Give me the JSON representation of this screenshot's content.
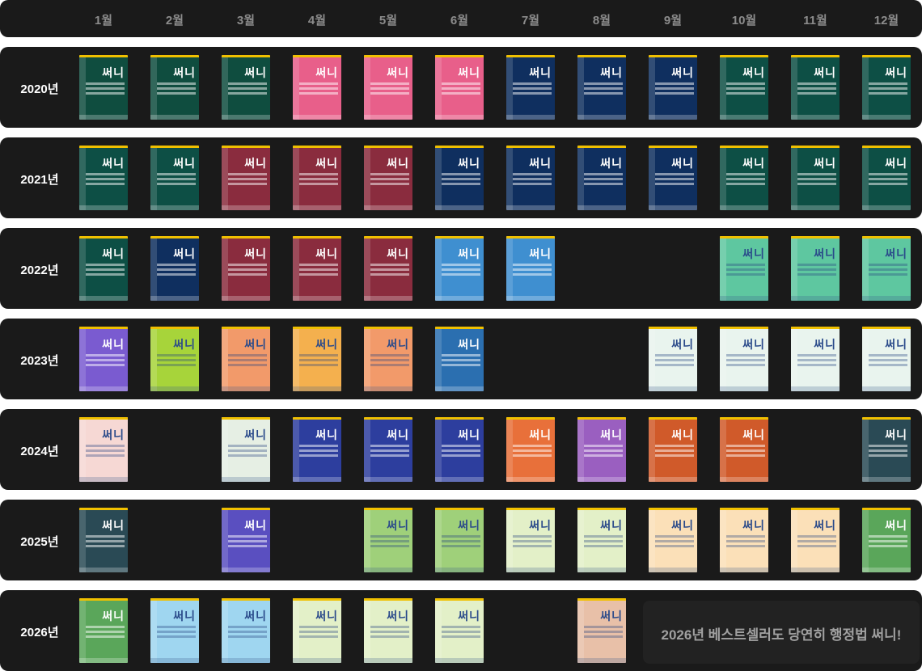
{
  "months": [
    "1월",
    "2월",
    "3월",
    "4월",
    "5월",
    "6월",
    "7월",
    "8월",
    "9월",
    "10월",
    "11월",
    "12월"
  ],
  "years": [
    "2020년",
    "2021년",
    "2022년",
    "2023년",
    "2024년",
    "2025년",
    "2026년"
  ],
  "book_brand": "써니",
  "rows": [
    {
      "year": "2020년",
      "covers": [
        "green",
        "green",
        "green",
        "pink",
        "pink",
        "pink",
        "navy",
        "navy",
        "navy",
        "teal",
        "teal",
        "teal"
      ]
    },
    {
      "year": "2021년",
      "covers": [
        "teal",
        "teal",
        "maroon",
        "maroon",
        "maroon",
        "navy",
        "navy",
        "navy",
        "navy",
        "teal",
        "teal",
        "teal"
      ]
    },
    {
      "year": "2022년",
      "covers": [
        "teal",
        "navy",
        "maroon",
        "maroon",
        "maroon",
        "sky",
        "sky",
        null,
        null,
        "mint",
        "mint",
        "mint"
      ]
    },
    {
      "year": "2023년",
      "covers": [
        "purple",
        "lime",
        "peach",
        "orange",
        "peach",
        "ocean",
        null,
        null,
        "seafoam",
        "seafoam",
        "seafoam",
        "seafoam"
      ]
    },
    {
      "year": "2024년",
      "covers": [
        "pastel",
        null,
        "botanic",
        "royal",
        "royal",
        "royal",
        "sunset",
        "violet",
        "dusk",
        "dusk",
        null,
        "night"
      ]
    },
    {
      "year": "2025년",
      "covers": [
        "night",
        null,
        "indigo",
        null,
        "field",
        "field",
        "lightgreen",
        "lightgreen",
        "cream",
        "cream",
        "cream",
        "meadow"
      ]
    },
    {
      "year": "2026년",
      "covers": [
        "meadow",
        "ice",
        "ice",
        "lightgreen",
        "lightgreen",
        "lightgreen",
        null,
        "blossom",
        null,
        null,
        null,
        null
      ]
    }
  ],
  "palette": {
    "green": "#0f4d3f",
    "teal": "#0d4f45",
    "pink": "#e85f8a",
    "navy": "#0f2f5f",
    "maroon": "#8a2c3e",
    "sky": "#3f8fd0",
    "mint": "#5ec7a0",
    "purple": "#7a5bd0",
    "lime": "#a7d43a",
    "peach": "#f29a6a",
    "orange": "#f4b04e",
    "ocean": "#2b6fb0",
    "seafoam": "#e9f4ee",
    "pastel": "#f6d8d4",
    "botanic": "#e6efe4",
    "royal": "#2d3e9e",
    "sunset": "#e8703a",
    "violet": "#9a5fc0",
    "dusk": "#d05a2a",
    "night": "#2a4a55",
    "indigo": "#5a4fc0",
    "field": "#9fd07a",
    "lightgreen": "#e3f0c8",
    "cream": "#fbe0b8",
    "meadow": "#5aa65a",
    "ice": "#9fd6f0",
    "blossom": "#e8c0a8"
  },
  "message": "2026년 베스트셀러도 당연히 행정법 써니!"
}
